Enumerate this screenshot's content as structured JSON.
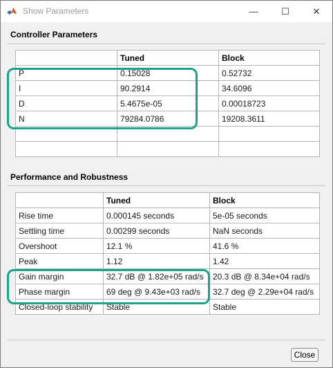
{
  "window": {
    "title": "Show Parameters",
    "controls": {
      "minimize": "—",
      "maximize": "☐",
      "close": "✕"
    }
  },
  "controller": {
    "heading": "Controller Parameters",
    "columns": [
      "",
      "Tuned",
      "Block"
    ],
    "rows": [
      [
        "P",
        "0.15028",
        "0.52732"
      ],
      [
        "I",
        "90.2914",
        "34.6096"
      ],
      [
        "D",
        "5.4675e-05",
        "0.00018723"
      ],
      [
        "N",
        "79284.0786",
        "19208.3611"
      ],
      [
        "",
        "",
        ""
      ],
      [
        "",
        "",
        ""
      ]
    ]
  },
  "performance": {
    "heading": "Performance and Robustness",
    "columns": [
      "",
      "Tuned",
      "Block"
    ],
    "rows": [
      [
        "Rise time",
        "0.000145 seconds",
        "5e-05 seconds"
      ],
      [
        "Settling time",
        "0.00299 seconds",
        "NaN seconds"
      ],
      [
        "Overshoot",
        "12.1 %",
        "41.6 %"
      ],
      [
        "Peak",
        "1.12",
        "1.42"
      ],
      [
        "Gain margin",
        "32.7 dB @ 1.82e+05 rad/s",
        "20.3 dB @ 8.34e+04 rad/s"
      ],
      [
        "Phase margin",
        "69 deg @ 9.43e+03 rad/s",
        "32.7 deg @ 2.29e+04 rad/s"
      ],
      [
        "Closed-loop stability",
        "Stable",
        "Stable"
      ]
    ]
  },
  "footer": {
    "close_label": "Close"
  },
  "colors": {
    "highlight": "#1aa38a",
    "grid_border": "#b4b4b4",
    "dialog_bg": "#f0f0f0"
  },
  "icons": {
    "app": "matlab-logo-icon"
  }
}
